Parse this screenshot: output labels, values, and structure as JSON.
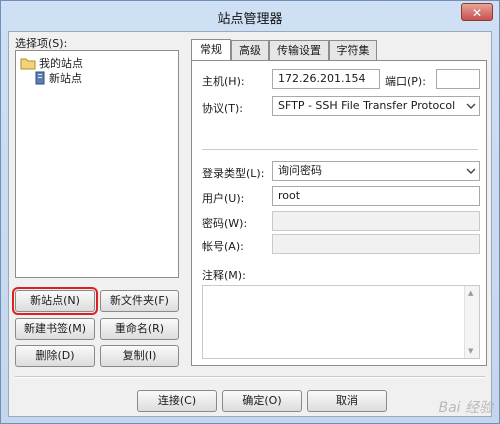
{
  "window": {
    "title": "站点管理器",
    "close_label": "✕"
  },
  "left": {
    "select_label": "选择项(S):",
    "tree": [
      {
        "label": "我的站点",
        "icon": "folder-icon"
      },
      {
        "label": "新站点",
        "icon": "server-icon"
      }
    ],
    "buttons": {
      "new_site": "新站点(N)",
      "new_folder": "新文件夹(F)",
      "new_bookmark": "新建书签(M)",
      "rename": "重命名(R)",
      "delete": "删除(D)",
      "copy": "复制(I)"
    }
  },
  "tabs": [
    "常规",
    "高级",
    "传输设置",
    "字符集"
  ],
  "general": {
    "host_label": "主机(H):",
    "host_value": "172.26.201.154",
    "port_label": "端口(P):",
    "port_value": "",
    "protocol_label": "协议(T):",
    "protocol_value": "SFTP - SSH File Transfer Protocol",
    "logon_label": "登录类型(L):",
    "logon_value": "询问密码",
    "user_label": "用户(U):",
    "user_value": "root",
    "password_label": "密码(W):",
    "account_label": "帐号(A):",
    "comments_label": "注释(M):"
  },
  "footer": {
    "connect": "连接(C)",
    "ok": "确定(O)",
    "cancel": "取消"
  },
  "watermark": "Bai 经验",
  "colors": {
    "highlight": "#e02020",
    "title_bar": "#c4d6ee"
  }
}
